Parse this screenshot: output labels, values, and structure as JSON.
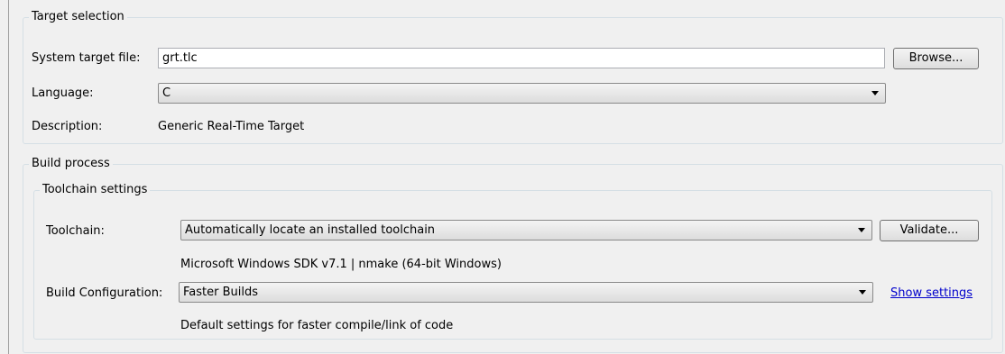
{
  "target_selection": {
    "title": "Target selection",
    "system_target_file_label": "System target file:",
    "system_target_file_value": "grt.tlc",
    "browse_button": "Browse...",
    "language_label": "Language:",
    "language_value": "C",
    "description_label": "Description:",
    "description_value": "Generic Real-Time Target"
  },
  "build_process": {
    "title": "Build process",
    "toolchain_settings": {
      "title": "Toolchain settings",
      "toolchain_label": "Toolchain:",
      "toolchain_value": "Automatically locate an installed toolchain",
      "validate_button": "Validate...",
      "toolchain_info": "Microsoft Windows SDK v7.1 | nmake (64-bit Windows)",
      "build_configuration_label": "Build Configuration:",
      "build_configuration_value": "Faster Builds",
      "show_settings_link": "Show settings",
      "build_configuration_description": "Default settings for faster compile/link of code"
    }
  },
  "icons": {
    "dropdown_arrow": "chevron-down-icon"
  }
}
